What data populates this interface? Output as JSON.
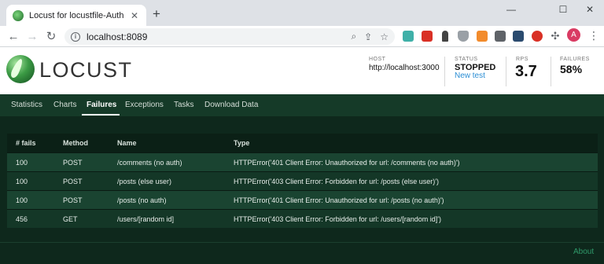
{
  "browser": {
    "tab_title": "Locust for locustfile-Authorization",
    "tab_close": "✕",
    "new_tab": "+",
    "minimize": "—",
    "maximize": "☐",
    "close": "✕",
    "url": "localhost:8089",
    "profile_initial": "A",
    "menu": "⋮",
    "back": "←",
    "forward": "→",
    "reload": "↻"
  },
  "header": {
    "logo": "LOCUST",
    "host_label": "HOST",
    "host_value": "http://localhost:3000",
    "status_label": "STATUS",
    "status_value": "STOPPED",
    "new_test": "New test",
    "rps_label": "RPS",
    "rps_value": "3.7",
    "failures_label": "FAILURES",
    "failures_value": "58%"
  },
  "nav": {
    "tabs": [
      {
        "label": "Statistics"
      },
      {
        "label": "Charts"
      },
      {
        "label": "Failures"
      },
      {
        "label": "Exceptions"
      },
      {
        "label": "Tasks"
      },
      {
        "label": "Download Data"
      }
    ],
    "active": "Failures"
  },
  "table": {
    "headers": [
      "# fails",
      "Method",
      "Name",
      "Type"
    ],
    "rows": [
      {
        "fails": "100",
        "method": "POST",
        "name": "/comments (no auth)",
        "type": "HTTPError('401 Client Error: Unauthorized for url: /comments (no auth)')"
      },
      {
        "fails": "100",
        "method": "POST",
        "name": "/posts (else user)",
        "type": "HTTPError('403 Client Error: Forbidden for url: /posts (else user)')"
      },
      {
        "fails": "100",
        "method": "POST",
        "name": "/posts (no auth)",
        "type": "HTTPError('401 Client Error: Unauthorized for url: /posts (no auth)')"
      },
      {
        "fails": "456",
        "method": "GET",
        "name": "/users/[random id]",
        "type": "HTTPError('403 Client Error: Forbidden for url: /users/[random id]')"
      }
    ]
  },
  "footer": {
    "about": "About"
  },
  "colors": {
    "accent": "#2f9a6a",
    "nav_bg": "#153a28",
    "content_bg": "#0e281c"
  }
}
